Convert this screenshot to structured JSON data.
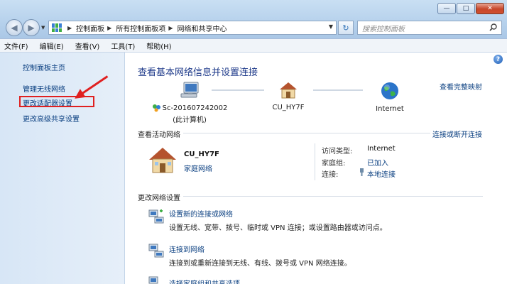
{
  "window": {
    "controls": {
      "minimize": "—",
      "maximize": "□",
      "close": "✕"
    }
  },
  "nav": {
    "back": "◀",
    "forward": "▶"
  },
  "address": {
    "crumbs": [
      "控制面板",
      "所有控制面板项",
      "网络和共享中心"
    ],
    "refresh": "↻"
  },
  "search": {
    "placeholder": "搜索控制面板",
    "icon": "search-icon"
  },
  "menu": {
    "items": [
      "文件(F)",
      "编辑(E)",
      "查看(V)",
      "工具(T)",
      "帮助(H)"
    ]
  },
  "sidebar": {
    "items": [
      {
        "label": "控制面板主页"
      },
      {
        "label": "管理无线网络"
      },
      {
        "label": "更改适配器设置"
      },
      {
        "label": "更改高级共享设置"
      }
    ],
    "annotation_color": "#e02020"
  },
  "main": {
    "help_label": "?",
    "heading": "查看基本网络信息并设置连接",
    "full_map_link": "查看完整映射",
    "map": {
      "computer": {
        "name": "Sc-201607242002",
        "sub": "(此计算机)",
        "icon": "computer-icon"
      },
      "network": {
        "name": "CU_HY7F",
        "icon": "house-icon"
      },
      "internet": {
        "name": "Internet",
        "icon": "globe-icon"
      }
    },
    "active": {
      "title": "查看活动网络",
      "connect_link": "连接或断开连接",
      "network_name": "CU_HY7F",
      "network_type": "家庭网络",
      "rows": [
        {
          "key": "访问类型:",
          "value": "Internet"
        },
        {
          "key": "家庭组:",
          "value": "已加入"
        },
        {
          "key": "连接:",
          "value": "本地连接"
        }
      ]
    },
    "change": {
      "title": "更改网络设置",
      "tasks": [
        {
          "link": "设置新的连接或网络",
          "desc": "设置无线、宽带、拨号、临时或 VPN 连接；或设置路由器或访问点。"
        },
        {
          "link": "连接到网络",
          "desc": "连接到或重新连接到无线、有线、拨号或 VPN 网络连接。"
        },
        {
          "link": "选择家庭组和共享选项",
          "desc": ""
        }
      ]
    }
  }
}
